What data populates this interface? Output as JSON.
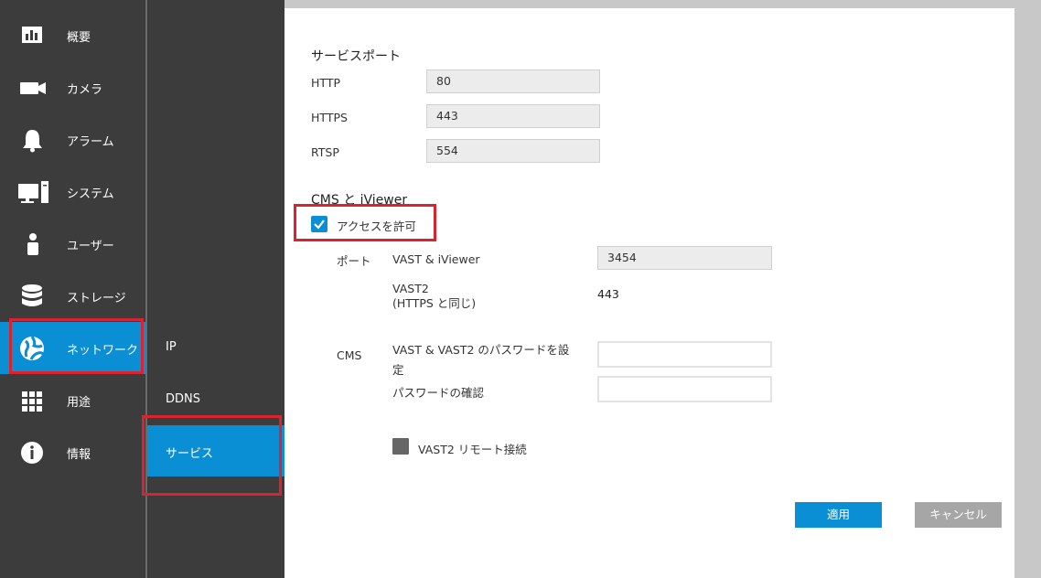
{
  "sidebar": {
    "items": [
      {
        "label": "概要",
        "icon": "bar-chart-icon"
      },
      {
        "label": "カメラ",
        "icon": "video-camera-icon"
      },
      {
        "label": "アラーム",
        "icon": "bell-icon"
      },
      {
        "label": "システム",
        "icon": "computer-icon"
      },
      {
        "label": "ユーザー",
        "icon": "user-icon"
      },
      {
        "label": "ストレージ",
        "icon": "database-icon"
      },
      {
        "label": "ネットワーク",
        "icon": "globe-icon"
      },
      {
        "label": "用途",
        "icon": "grid-icon"
      },
      {
        "label": "情報",
        "icon": "info-icon"
      }
    ],
    "active": "ネットワーク"
  },
  "subnav": {
    "items": [
      {
        "label": "IP"
      },
      {
        "label": "DDNS"
      },
      {
        "label": "サービス"
      }
    ],
    "active": "サービス"
  },
  "service_port": {
    "title": "サービスポート",
    "http_label": "HTTP",
    "http_value": "80",
    "https_label": "HTTPS",
    "https_value": "443",
    "rtsp_label": "RTSP",
    "rtsp_value": "554"
  },
  "cms": {
    "title": "CMS と iViewer",
    "allow_access_label": "アクセスを許可",
    "allow_access_checked": true,
    "port_label": "ポート",
    "vast_iviewer_label": "VAST & iViewer",
    "vast_iviewer_value": "3454",
    "vast2_label_line1": "VAST2",
    "vast2_label_line2": "(HTTPS と同じ)",
    "vast2_value": "443",
    "cms_label": "CMS",
    "password_label_line1": "VAST & VAST2 のパスワードを設",
    "password_label_line2": "定",
    "password_value": "",
    "confirm_label": "パスワードの確認",
    "confirm_value": "",
    "remote_label": "VAST2 リモート接続",
    "remote_checked": false
  },
  "buttons": {
    "apply": "適用",
    "cancel": "キャンセル"
  },
  "colors": {
    "accent": "#0a8fd4",
    "sidebar_bg": "#3c3c3c",
    "highlight_box": "#d9232e",
    "cancel_bg": "#a6a6a6"
  }
}
